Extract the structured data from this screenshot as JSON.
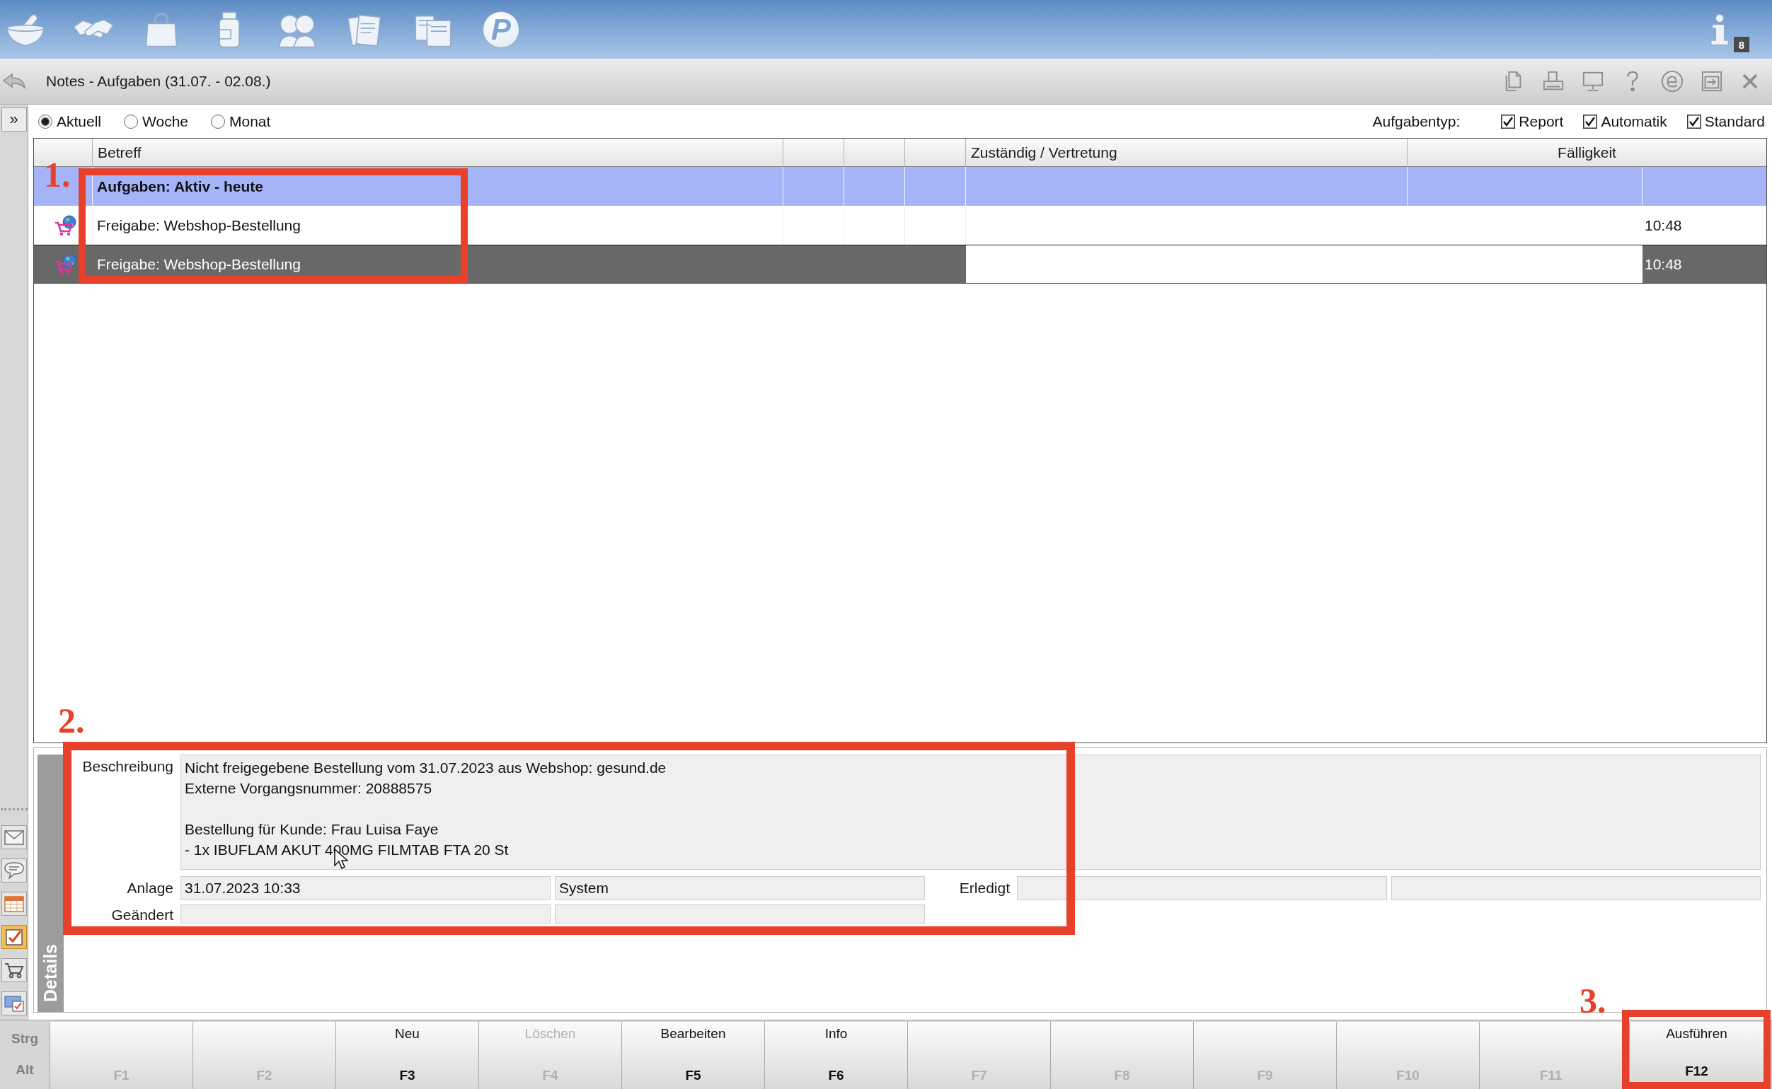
{
  "toolbar": {
    "logo_letter": "P",
    "info_badge": "8"
  },
  "window": {
    "title": "Notes - Aufgaben (31.07. - 02.08.)"
  },
  "sidebar": {
    "expand_glyph": "»",
    "items": [
      {
        "selected": false
      },
      {
        "selected": false
      },
      {
        "selected": false
      },
      {
        "selected": true
      },
      {
        "selected": false
      },
      {
        "selected": false
      }
    ]
  },
  "period": [
    {
      "label": "Aktuell",
      "selected": true
    },
    {
      "label": "Woche",
      "selected": false
    },
    {
      "label": "Monat",
      "selected": false
    }
  ],
  "task_type": {
    "label": "Aufgabentyp:",
    "options": [
      {
        "label": "Report",
        "checked": true
      },
      {
        "label": "Automatik",
        "checked": true
      },
      {
        "label": "Standard",
        "checked": true
      }
    ]
  },
  "table": {
    "columns": [
      "Betreff",
      "Zuständig / Vertretung",
      "Fälligkeit"
    ],
    "rows": [
      {
        "kind": "group",
        "subject": "Aufgaben: Aktiv - heute",
        "selected": false
      },
      {
        "kind": "task",
        "subject": "Freigabe: Webshop-Bestellung",
        "due": "10:48",
        "selected": false
      },
      {
        "kind": "task",
        "subject": "Freigabe: Webshop-Bestellung",
        "due": "10:48",
        "selected": true
      }
    ]
  },
  "details": {
    "tab": "Details",
    "description": {
      "label": "Beschreibung",
      "value": "Nicht freigegebene Bestellung vom 31.07.2023 aus Webshop: gesund.de\nExterne Vorgangsnummer: 20888575\n\nBestellung für Kunde: Frau Luisa Faye\n- 1x IBUFLAM AKUT 400MG FILMTAB FTA 20 St"
    },
    "created": {
      "label": "Anlage",
      "date": "31.07.2023 10:33",
      "by": "System"
    },
    "completed": {
      "label": "Erledigt"
    },
    "changed": {
      "label": "Geändert"
    }
  },
  "function_keys": {
    "modifiers": [
      "Strg",
      "Alt"
    ],
    "keys": [
      {
        "key": "F1",
        "disabled": true
      },
      {
        "key": "F2",
        "disabled": true
      },
      {
        "key": "F3",
        "label": "Neu",
        "disabled": false
      },
      {
        "key": "F4",
        "label": "Löschen",
        "disabled": true
      },
      {
        "key": "F5",
        "label": "Bearbeiten",
        "disabled": false
      },
      {
        "key": "F6",
        "label": "Info",
        "disabled": false
      },
      {
        "key": "F7",
        "disabled": true
      },
      {
        "key": "F8",
        "disabled": true
      },
      {
        "key": "F9",
        "disabled": true
      },
      {
        "key": "F10",
        "disabled": true
      },
      {
        "key": "F11",
        "disabled": true
      },
      {
        "key": "F12",
        "label": "Ausführen",
        "disabled": false
      }
    ]
  },
  "annotations": [
    {
      "label": "1."
    },
    {
      "label": "2."
    },
    {
      "label": "3."
    }
  ]
}
